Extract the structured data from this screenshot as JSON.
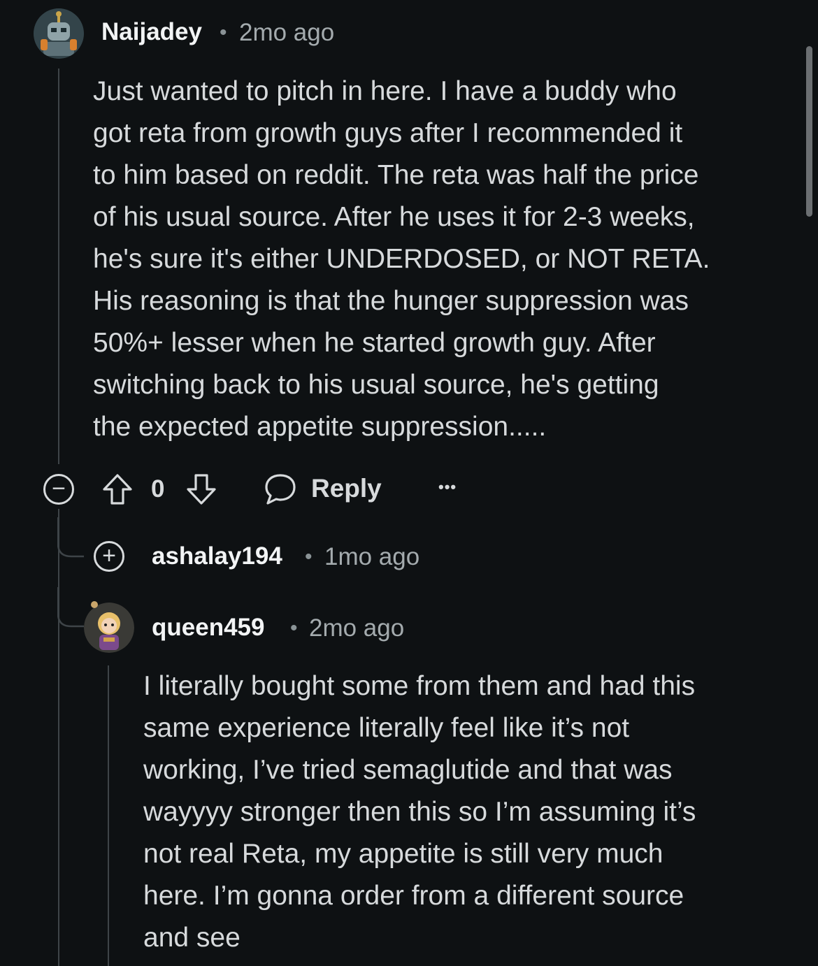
{
  "comments": [
    {
      "username": "Naijadey",
      "separator": "•",
      "time": "2mo ago",
      "body": "Just wanted to pitch in here. I have a buddy who\ngot reta from growth guys after I recommended it\nto him based on reddit. The reta was half the price\nof his usual source. After he uses it for 2-3 weeks,\nhe's sure it's either UNDERDOSED, or NOT RETA.\nHis reasoning is that the hunger suppression was\n50%+ lesser when he started growth guy. After\nswitching back to his usual source, he's getting\nthe expected appetite suppression.....",
      "actions": {
        "collapse_symbol": "−",
        "vote_count": "0",
        "reply_label": "Reply",
        "more_symbol": "•••"
      }
    },
    {
      "username": "ashalay194",
      "separator": "•",
      "time": "1mo ago",
      "expand_symbol": "+"
    },
    {
      "username": "queen459",
      "separator": "•",
      "time": "2mo ago",
      "body": "I literally bought some from them and had this\nsame experience literally feel like it’s not\nworking, I’ve tried semaglutide and that was\nwayyyy stronger then this so I’m assuming it’s\nnot real Reta, my appetite is still very much\nhere. I’m gonna order from a different source\nand see"
    }
  ],
  "colors": {
    "background": "#0e1113",
    "text": "#d7dadc",
    "meta": "#a4abae",
    "thread_line": "#3e4448"
  }
}
